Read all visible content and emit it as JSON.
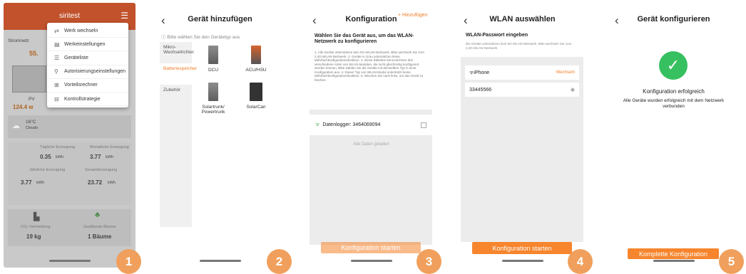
{
  "s1": {
    "app_title": "siritest",
    "stromnetz": "Stromnetz",
    "val_55": "55.",
    "pv_label": "PV",
    "pv_value": "124.4 w",
    "weather_temp": "16°C",
    "weather_desc": "Clouds",
    "menu": [
      {
        "icon": "⇄",
        "label": "Werk wechseln"
      },
      {
        "icon": "▤",
        "label": "Werkeinstellungen"
      },
      {
        "icon": "☰",
        "label": "Geräteliste"
      },
      {
        "icon": "⚲",
        "label": "Autorisierungseinstellungen"
      },
      {
        "icon": "⊞",
        "label": "Vorteilsrechner"
      },
      {
        "icon": "⊟",
        "label": "Kontrollstrategie"
      }
    ],
    "stats": [
      {
        "label": "Tägliche Erzeugung",
        "value": "0.35",
        "unit": "kWh"
      },
      {
        "label": "Monatliche Erzeugung",
        "value": "3.77",
        "unit": "kWh"
      },
      {
        "label": "Jährliche Erzeugung",
        "value": "3.77",
        "unit": "kWh"
      },
      {
        "label": "Gesamterzeugung",
        "value": "23.72",
        "unit": "kWh"
      }
    ],
    "co2_label": "CO₂-Vermeidung",
    "co2_value": "19 kg",
    "trees_label": "Gepflanzte Bäume",
    "trees_value": "1 Bäume",
    "badge": "1"
  },
  "s2": {
    "title": "Gerät hinzufügen",
    "hint": "ⓘ Bitte wählen Sie den Gerätetyp aus",
    "categories": [
      "Mikro-Wechselrichter",
      "Batteriespeicher",
      "Zubehör"
    ],
    "devices": [
      "DCU",
      "ACU/HSU",
      "Solartrunk/ Powertrunk",
      "SolarCan"
    ],
    "badge": "2"
  },
  "s3": {
    "title": "Konfiguration",
    "add": "Hinzufügen",
    "heading": "Wählen Sie das Gerät aus, um das WLAN-Netzwerk zu konfigurieren",
    "instructions": "1. Alle Geräte unterstützen kein 5G-WLAN-Netzwerk. Bitte wechseln Sie zum 2,4G-WLAN-Netzwerk. 2. Geräte in Grau unterstützen keine Mehrfachkonfigurationsfunktion. 3. Diese Etiketten kennzeichnen drei verschiedene Arten von WLAN-Modulen, die nicht gleichzeitig konfiguriert werden können. Bitte wählen Sie die Geräte mit demselben Typ in einer Konfiguration aus. 4. Dieser Typ von WLAN-Modul unterstützt keine Mehrfachkonfigurationsfunktion. 5. Wischen Sie nach links, um das Gerät zu löschen.",
    "logger": "Datenlogger: 3464069094",
    "loaded": "Alle Daten geladen",
    "start": "Konfiguration starten",
    "badge": "3"
  },
  "s4": {
    "title": "WLAN auswählen",
    "label": "WLAN-Passwort eingeben",
    "sub": "Die Geräte unterstützen kein 5G-WLAN-Netzwerk. Bitte wechseln Sie zum 2,4G-WLAN-Netzwerk",
    "ssid": "iPhone",
    "switch": "Wechseln",
    "password": "33445566",
    "start": "Konfiguration starten",
    "badge": "4"
  },
  "s5": {
    "title": "Gerät konfigurieren",
    "success": "Konfiguration erfolgreich",
    "message": "Alle Geräte wurden erfolgreich mit dem Netzwerk verbunden",
    "complete": "Komplette Konfiguration",
    "badge": "5"
  }
}
